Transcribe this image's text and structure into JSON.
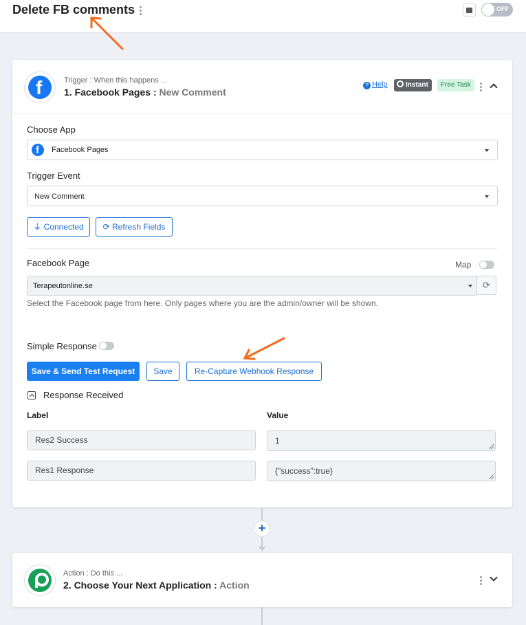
{
  "header": {
    "workflow_title": "Delete FB comments",
    "toggle_label": "OFF"
  },
  "trigger_step": {
    "caption": "Trigger : When this happens ...",
    "number_app": "1. Facebook Pages :",
    "event": "New Comment",
    "help_label": "Help",
    "instant_label": "Instant",
    "free_task_label": "Free Task",
    "choose_app_label": "Choose App",
    "choose_app_value": "Facebook Pages",
    "trigger_event_label": "Trigger Event",
    "trigger_event_value": "New Comment",
    "connected_label": "Connected",
    "refresh_fields_label": "Refresh Fields",
    "facebook_page_label": "Facebook Page",
    "map_label": "Map",
    "facebook_page_value": "Terapeutonline.se",
    "facebook_page_hint": "Select the Facebook page from here. Only pages where you are the admin/owner will be shown.",
    "simple_response_label": "Simple Response",
    "save_send_label": "Save & Send Test Request",
    "save_label": "Save",
    "recapture_label": "Re-Capture Webhook Response",
    "response_received_label": "Response Received",
    "table": {
      "label_header": "Label",
      "value_header": "Value",
      "rows": [
        {
          "label": "Res2 Success",
          "value": "1"
        },
        {
          "label": "Res1 Response",
          "value": "{\"success\":true}"
        }
      ]
    }
  },
  "action_step": {
    "caption": "Action : Do this ...",
    "number_app": "2. Choose Your Next Application :",
    "event": "Action"
  },
  "colors": {
    "accent": "#1a6fd6",
    "primary_button": "#1a7ff0",
    "annotation_arrow": "#f26b1d",
    "facebook": "#1877f2",
    "pabbly_green": "#18a058"
  }
}
